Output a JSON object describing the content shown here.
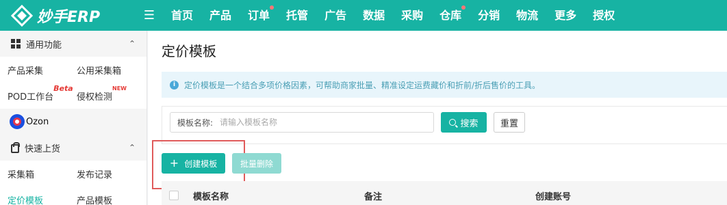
{
  "brand": {
    "name": "妙手ERP"
  },
  "nav": {
    "items": [
      {
        "label": "首页",
        "dot": false
      },
      {
        "label": "产品",
        "dot": false
      },
      {
        "label": "订单",
        "dot": true
      },
      {
        "label": "托管",
        "dot": false
      },
      {
        "label": "广告",
        "dot": false
      },
      {
        "label": "数据",
        "dot": false
      },
      {
        "label": "采购",
        "dot": false
      },
      {
        "label": "仓库",
        "dot": true
      },
      {
        "label": "分销",
        "dot": false
      },
      {
        "label": "物流",
        "dot": false
      },
      {
        "label": "更多",
        "dot": false
      },
      {
        "label": "授权",
        "dot": false
      }
    ]
  },
  "sidebar": {
    "group1": {
      "title": "通用功能",
      "chevron": "^"
    },
    "row1": [
      "产品采集",
      "公用采集箱"
    ],
    "row2": {
      "left": "POD工作台",
      "left_badge": "Beta",
      "right": "侵权检测",
      "right_badge": "NEW"
    },
    "platform": "Ozon",
    "group2": {
      "title": "快速上货",
      "chevron": "^"
    },
    "row3": [
      "采集箱",
      "发布记录"
    ],
    "row4": [
      "定价模板",
      "产品模板"
    ]
  },
  "main": {
    "title": "定价模板",
    "info": "定价模板是一个结合多项价格因素，可帮助商家批量、精准设定运费藏价和折前/折后售价的工具。",
    "filter": {
      "label": "模板名称:",
      "placeholder": "请输入模板名称",
      "search_label": "搜索",
      "reset_label": "重置"
    },
    "actions": {
      "create_label": "创建模板",
      "bulk_delete_label": "批量删除"
    },
    "table": {
      "columns": [
        "模板名称",
        "备注",
        "创建账号"
      ]
    }
  },
  "colors": {
    "primary": "#17b3a3",
    "badge": "#e53935",
    "highlight": "#e05a5a"
  }
}
